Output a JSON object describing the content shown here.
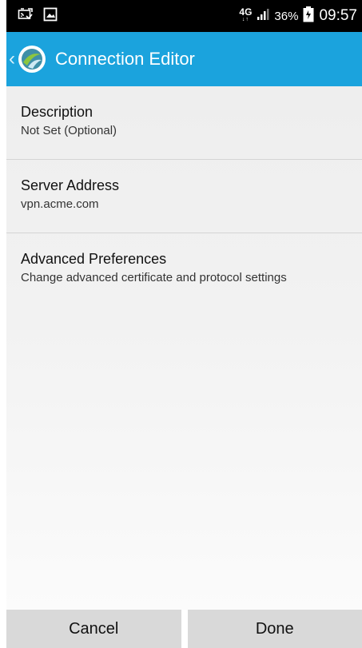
{
  "status_bar": {
    "network": "4G",
    "network_arrows": "↓↑",
    "battery_percent": "36%",
    "time": "09:57",
    "icons": [
      "cast-icon",
      "image-icon",
      "signal-icon",
      "battery-icon"
    ]
  },
  "app_bar": {
    "title": "Connection Editor",
    "back_icon": "chevron-left-icon",
    "logo_icon": "anyconnect-logo-icon",
    "color": "#1ba3dd"
  },
  "preferences": [
    {
      "title": "Description",
      "summary": "Not Set (Optional)"
    },
    {
      "title": "Server Address",
      "summary": "vpn.acme.com"
    },
    {
      "title": "Advanced Preferences",
      "summary": "Change advanced certificate and protocol settings"
    }
  ],
  "buttons": {
    "cancel_label": "Cancel",
    "done_label": "Done"
  }
}
